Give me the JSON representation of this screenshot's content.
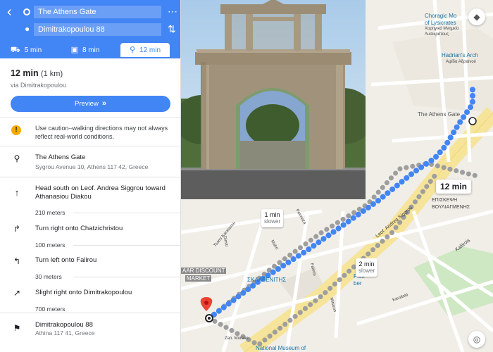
{
  "origin": {
    "value": "The Athens Gate"
  },
  "destination": {
    "value": "Dimitrakopoulou 88"
  },
  "modes": [
    {
      "icon": "car-icon",
      "label": "5 min"
    },
    {
      "icon": "transit-icon",
      "label": "8 min"
    },
    {
      "icon": "walk-icon",
      "label": "12 min"
    }
  ],
  "summary": {
    "time": "12 min",
    "distance": "(1 km)",
    "via": "via Dimitrakopoulou",
    "preview": "Preview"
  },
  "warning": "Use caution–walking directions may not always reflect real-world conditions.",
  "start": {
    "title": "The Athens Gate",
    "address": "Sygrou Avenue 10, Athens 117 42, Greece"
  },
  "steps": [
    {
      "icon": "arrow-up-icon",
      "text": "Head south on Leof. Andrea Siggrou toward Athanasiou Diakou",
      "distance": "210 meters"
    },
    {
      "icon": "turn-right-icon",
      "text": "Turn right onto Chatzichristou",
      "distance": "100 meters"
    },
    {
      "icon": "turn-left-icon",
      "text": "Turn left onto Falirou",
      "distance": "30 meters"
    },
    {
      "icon": "slight-right-icon",
      "text": "Slight right onto Dimitrakopoulou",
      "distance": "700 meters"
    }
  ],
  "end": {
    "title": "Dimitrakopoulou 88",
    "address": "Athina 117 41, Greece"
  },
  "map": {
    "main_time": "12 min",
    "alt1": {
      "time": "1 min",
      "note": "slower"
    },
    "alt2": {
      "time": "2 min",
      "note": "slower"
    },
    "labels": {
      "choragic1": "Choragic Mo",
      "choragic2": "of Lysicrates",
      "choragic3": "Χορηγικό Μνημείο",
      "choragic4": "Λυσικράτους",
      "hadrian1": "Hadrian's Arch",
      "hadrian2": "Αψίδα Αδριανού",
      "athens_gate": "The Athens Gate",
      "vouliag1": "ΕΠΙΣΚΕΨΗ",
      "vouliag2": "ΒΟΥΛΙΑΓΜΕΝΗΣ",
      "andrea": "Leof. Andrea Siggrou",
      "kallirois": "Kallirois",
      "discount1": "AAR DISCOUNT",
      "discount2": "MARKET",
      "sklav": "ΣΚΛΑΒΕΝΙΤΗΣ",
      "phix": "Phix",
      "phix2": "ber",
      "museum": "National Museum of",
      "tsami": "Tsami Karatasou",
      "dimi": "Dimitr",
      "petmeza": "Petmeza",
      "makri": "Makri",
      "falirou": "Falirou",
      "mitseon": "Mitseon",
      "moreas": "Zan. Moreas",
      "kavalotti": "Kavalotti"
    }
  },
  "colors": {
    "accent": "#4285f4",
    "route": "#4285f4",
    "alt_route": "#9e9e9e",
    "pin": "#ea4335"
  }
}
